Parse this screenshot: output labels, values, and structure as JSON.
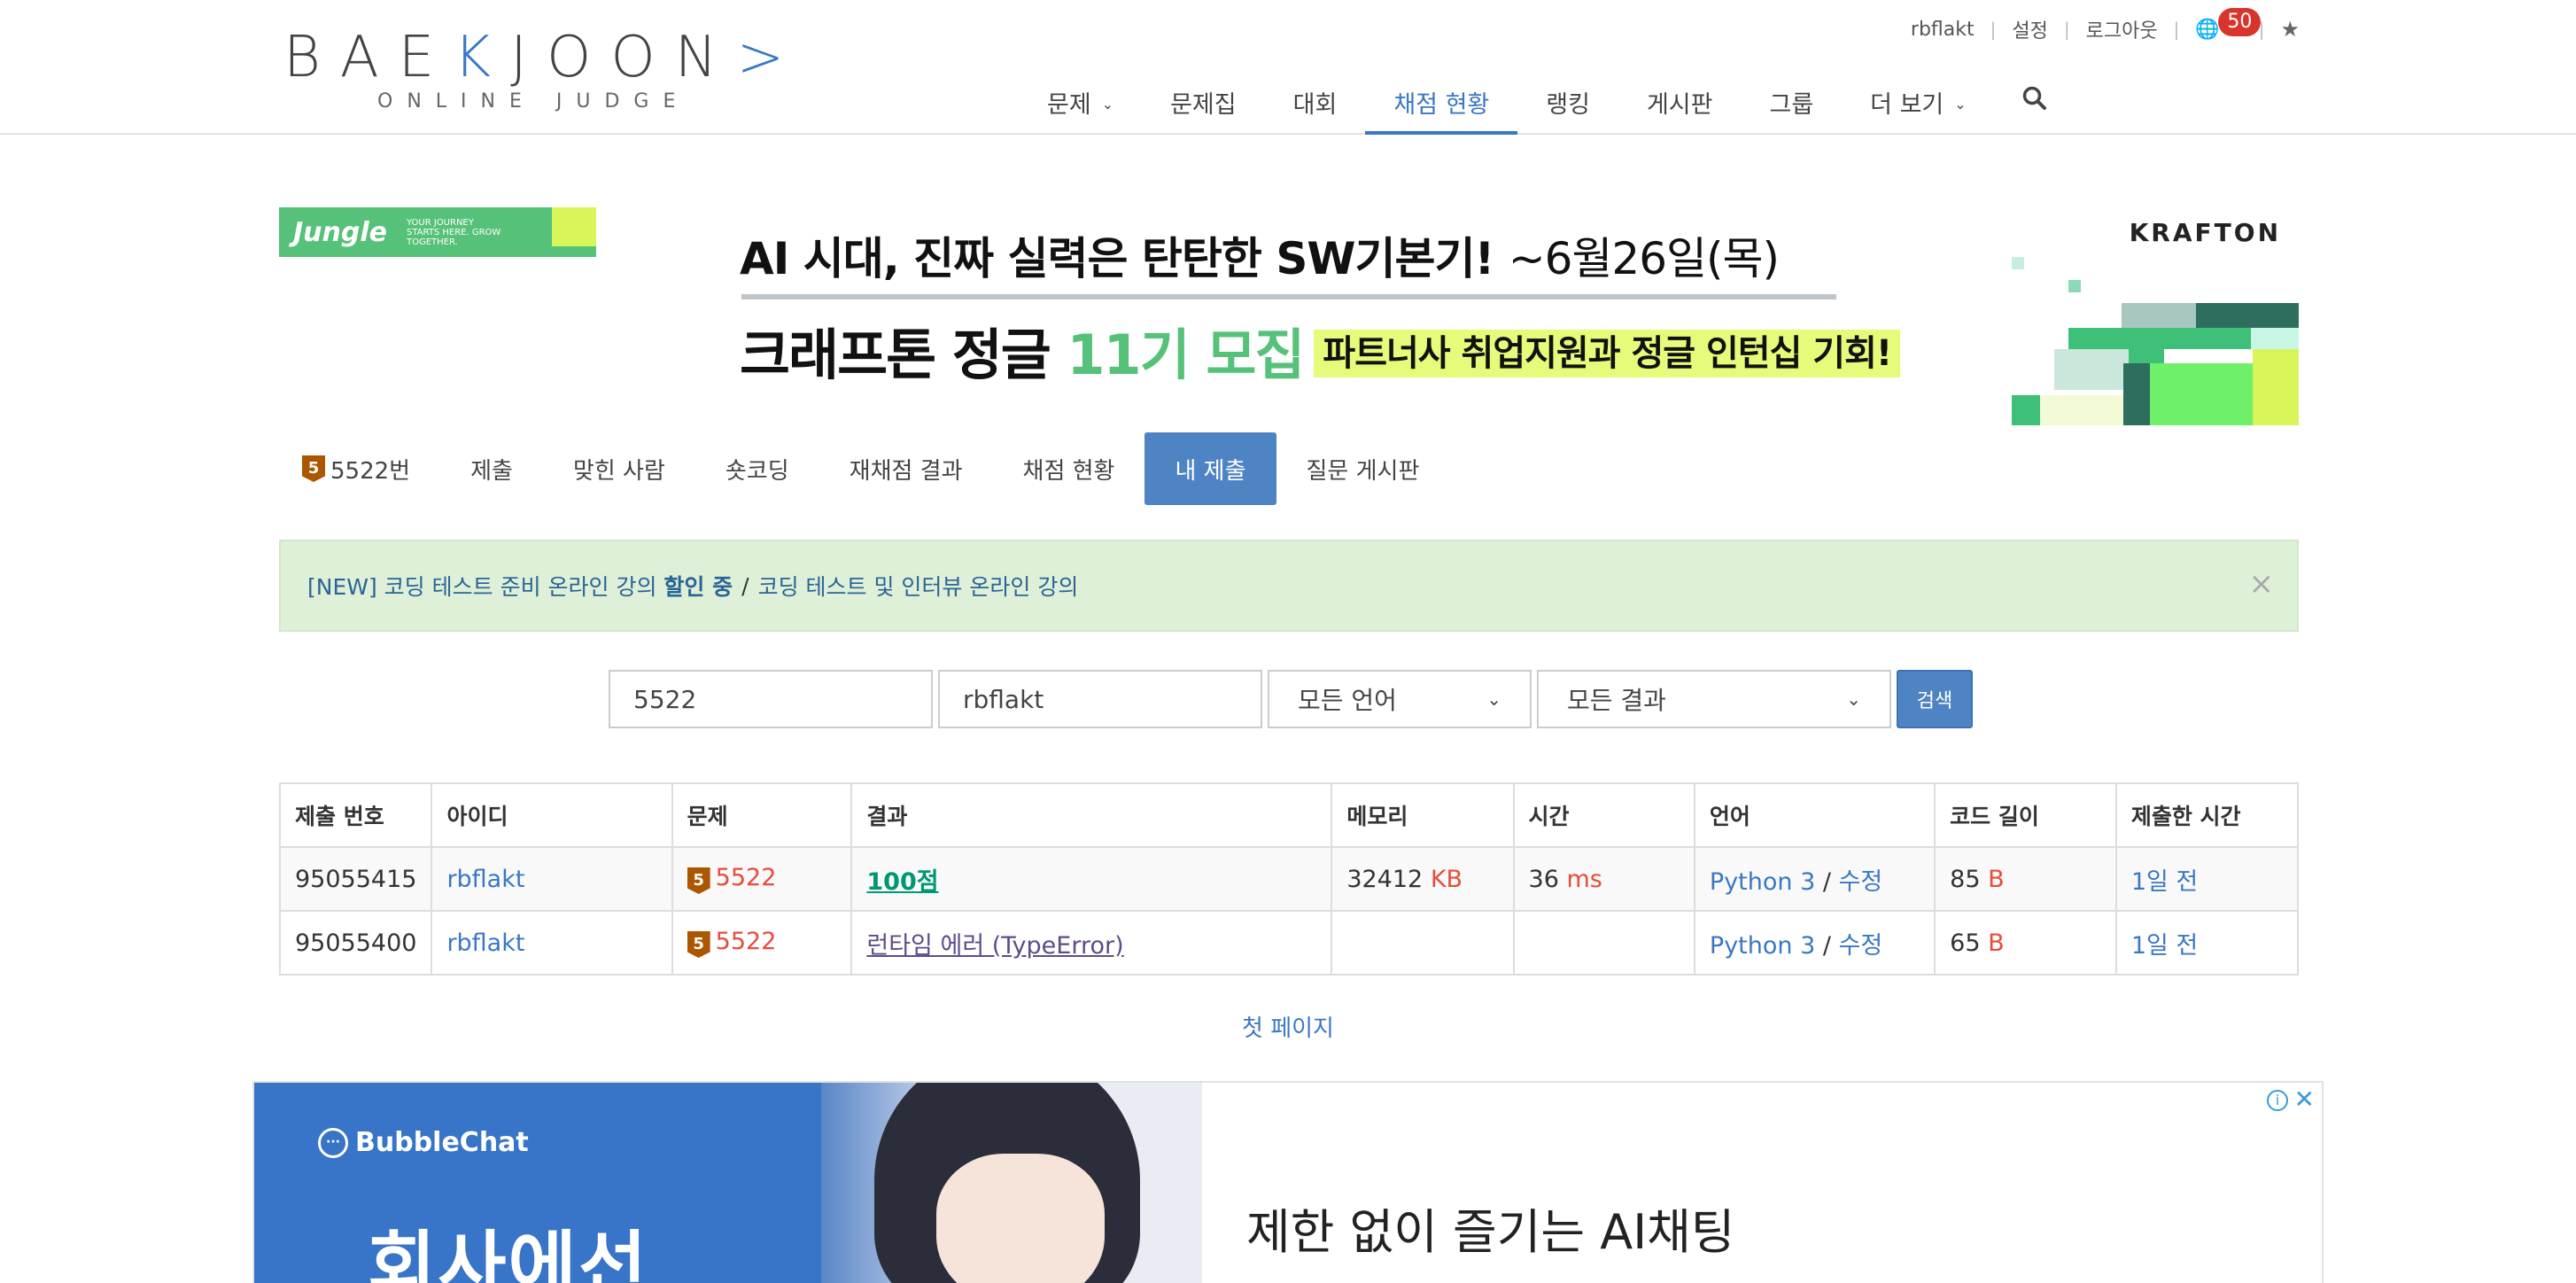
{
  "header": {
    "logo_main_1": "BAE",
    "logo_main_accent": "K",
    "logo_main_2": "JOON",
    "logo_main_accent2": ">",
    "logo_sub": "ONLINE JUDGE",
    "user": "rbflakt",
    "settings": "설정",
    "logout": "로그아웃",
    "notification_count": "50",
    "nav": [
      {
        "label": "문제",
        "dropdown": true
      },
      {
        "label": "문제집"
      },
      {
        "label": "대회"
      },
      {
        "label": "채점 현황",
        "active": true
      },
      {
        "label": "랭킹"
      },
      {
        "label": "게시판"
      },
      {
        "label": "그룹"
      },
      {
        "label": "더 보기",
        "dropdown": true
      }
    ]
  },
  "banner": {
    "jungle_logo": "Jungle",
    "jungle_tagline": "YOUR JOURNEY STARTS HERE. GROW TOGETHER.",
    "line1_bold": "AI 시대, 진짜 실력은 탄탄한 SW기본기!",
    "line1_date": "~6월26일(목)",
    "line2_part1": "크래프톤 정글",
    "line2_green": "11기 모집",
    "line2_highlight": "파트너사 취업지원과 정글 인턴십 기회!",
    "brand": "KRAFTON"
  },
  "problem_tabs": {
    "tier": "5",
    "items": [
      "5522번",
      "제출",
      "맞힌 사람",
      "숏코딩",
      "재채점 결과",
      "채점 현황",
      "내 제출",
      "질문 게시판"
    ],
    "active_index": 6
  },
  "alert": {
    "text1": "[NEW] 코딩 테스트 준비 온라인 강의",
    "text1_bold": "할인 중",
    "slash": "/",
    "text2": "코딩 테스트 및 인터뷰 온라인 강의",
    "close": "×"
  },
  "search": {
    "problem_id": "5522",
    "user_id": "rbflakt",
    "language": "모든 언어",
    "result": "모든 결과",
    "button": "검색"
  },
  "table": {
    "headers": [
      "제출 번호",
      "아이디",
      "문제",
      "결과",
      "메모리",
      "시간",
      "언어",
      "코드 길이",
      "제출한 시간"
    ],
    "rows": [
      {
        "id": "95055415",
        "user": "rbflakt",
        "tier": "5",
        "problem": "5522",
        "result": "100점",
        "memory": "32412",
        "memory_unit": "KB",
        "time": "36",
        "time_unit": "ms",
        "language": "Python 3",
        "edit": "수정",
        "length": "85",
        "length_unit": "B",
        "submitted": "1일 전"
      },
      {
        "id": "95055400",
        "user": "rbflakt",
        "tier": "5",
        "problem": "5522",
        "result": "런타임 에러 (TypeError)",
        "memory": "",
        "memory_unit": "",
        "time": "",
        "time_unit": "",
        "language": "Python 3",
        "edit": "수정",
        "length": "65",
        "length_unit": "B",
        "submitted": "1일 전"
      }
    ],
    "separator": "/"
  },
  "pagination": {
    "first_page": "첫 페이지"
  },
  "ad": {
    "brand": "BubbleChat",
    "big_text": "회사에선",
    "headline": "제한 없이 즐기는 AI채팅",
    "info": "i",
    "close": "✕"
  },
  "colors": {
    "accent": "#3a77c4",
    "alert_bg": "#dff0d8",
    "accepted": "#009874",
    "error": "#5f4b8b",
    "bronze": "#ad5600",
    "jungle_green": "#56c178"
  }
}
